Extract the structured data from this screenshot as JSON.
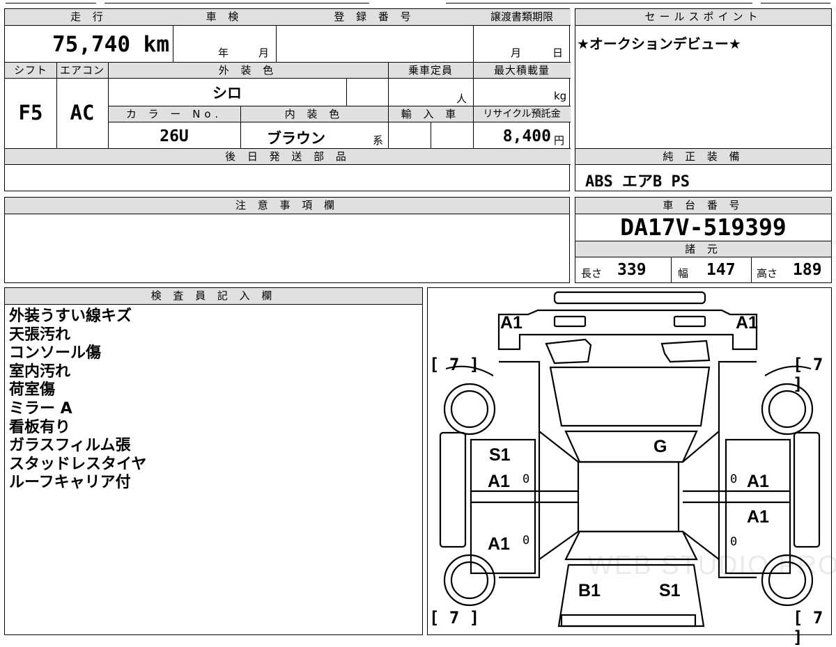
{
  "top_info": {
    "header": {
      "mileage": "走 行",
      "inspection": "車 検",
      "registration": "登 録 番 号",
      "transfer_deadline": "譲渡書類期限",
      "sales_point": "セールスポイント"
    },
    "mileage_value": "75,740 km",
    "inspection_year_unit": "年",
    "inspection_month_unit": "月",
    "transfer_month_unit": "月",
    "transfer_day_unit": "日",
    "sales_point_text": "★オークションデビュー★",
    "row2_header": {
      "shift": "シフト",
      "aircon": "エアコン",
      "exterior_color": "外 装 色",
      "capacity": "乗車定員",
      "max_load": "最大積載量"
    },
    "shift_value": "F5",
    "aircon_value": "AC",
    "exterior_color_value": "シロ",
    "capacity_unit": "人",
    "max_load_unit": "kg",
    "row3_header": {
      "color_no": "カ ラ ー No.",
      "interior_color": "内 装 色",
      "import": "輸 入 車",
      "recycle": "リサイクル預託金"
    },
    "color_no_value": "26U",
    "interior_color_value": "ブラウン",
    "interior_suffix": "系",
    "recycle_value": "8,400",
    "recycle_unit": "円",
    "later_parts_header": "後 日 発 送 部 品",
    "genuine_equipment_header": "純 正 装 備",
    "genuine_equipment_value": "ABS エアB PS"
  },
  "notes": {
    "header": "注 意 事 項 欄"
  },
  "chassis": {
    "header": "車 台 番 号",
    "value": "DA17V-519399",
    "spec_header": "諸 元",
    "length_label": "長さ",
    "length_value": "339",
    "width_label": "幅",
    "width_value": "147",
    "height_label": "高さ",
    "height_value": "189"
  },
  "inspector": {
    "header": "検 査 員 記 入 欄",
    "lines": [
      "外装うすい線キズ",
      "天張汚れ",
      "コンソール傷",
      "室内汚れ",
      "荷室傷",
      "ミラー A",
      "看板有り",
      "ガラスフィルム張",
      "スタッドレスタイヤ",
      "ルーフキャリア付"
    ]
  },
  "diagram": {
    "tire_marks": [
      "[ 7 ]",
      "[ 7 ]",
      "[ 7 ]",
      "[ 7 ]"
    ],
    "labels": {
      "front_left": "A1",
      "front_right": "A1",
      "left_front_door_1": "S1",
      "left_front_door_2": "A1",
      "left_rear_door": "A1",
      "right_front_door": "A1",
      "right_rear_door": "A1",
      "glass": "G",
      "rear_left": "B1",
      "rear_right": "S1"
    },
    "zero_mark": "0",
    "watermark": "WEB STUDIO PRO"
  }
}
